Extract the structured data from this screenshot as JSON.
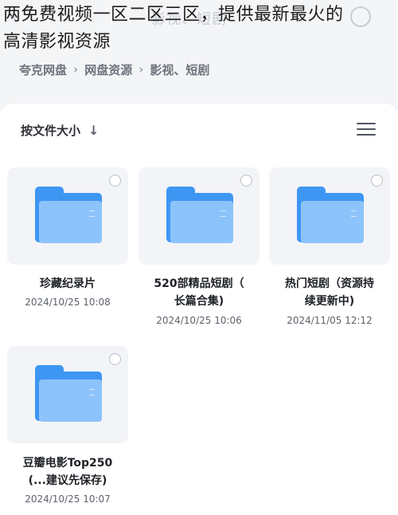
{
  "overlay": {
    "line1": "两免费视频一区二区三区，提供最新最火的",
    "line2": "高清影视资源"
  },
  "header": {
    "title": "影视、短剧"
  },
  "breadcrumb": {
    "items": [
      "夸克网盘",
      "网盘资源",
      "影视、短剧"
    ],
    "separator": "›"
  },
  "toolbar": {
    "sort_label": "按文件大小",
    "sort_direction_icon": "arrow-down-icon",
    "view_icon": "list-view-icon"
  },
  "colors": {
    "folder_back": "#3e96f3",
    "folder_front": "#8cc3fb"
  },
  "files": [
    {
      "name_line1": "珍藏纪录片",
      "name_line2": "",
      "date": "2024/10/25 10:08"
    },
    {
      "name_line1": "520部精品短剧（",
      "name_line2": "长篇合集)",
      "date": "2024/10/25 10:06"
    },
    {
      "name_line1": "热门短剧（资源持",
      "name_line2": "续更新中)",
      "date": "2024/11/05 12:12"
    },
    {
      "name_line1": "豆瓣电影Top250",
      "name_line2": "(...建议先保存)",
      "date": "2024/10/25 10:07"
    }
  ]
}
